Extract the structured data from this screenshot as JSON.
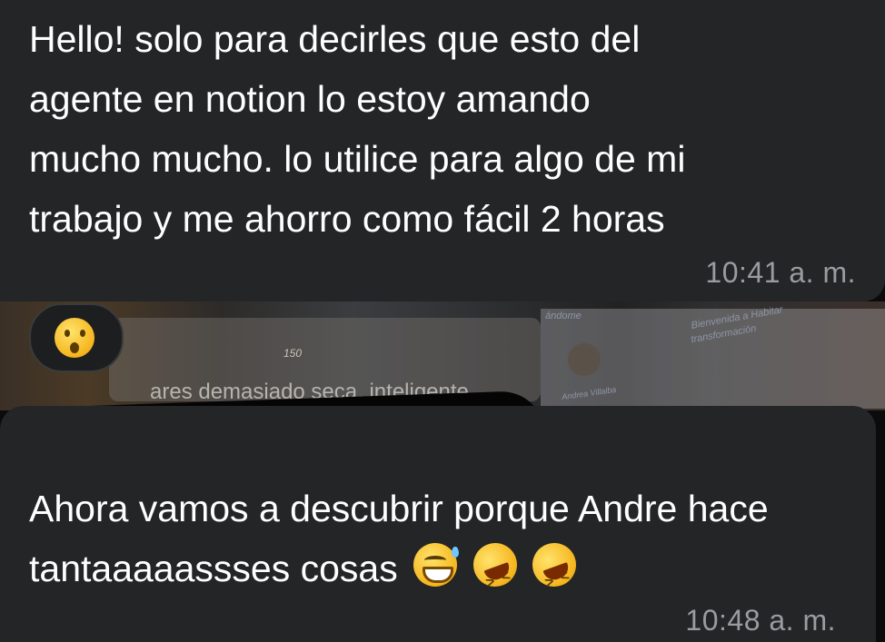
{
  "messages": [
    {
      "text": "Hello! solo para decirles que esto del\nagente en notion lo estoy amando\nmucho mucho. lo utilice para algo de mi\ntrabajo y me ahorro como fácil 2 horas",
      "time": "10:41 a. m."
    },
    {
      "text": "Ahora vamos a descubrir porque Andre hace tantaaaaassses cosas",
      "time": "10:48 a. m.",
      "emojis": [
        "grinning-sweat-icon",
        "rofl-icon",
        "rofl-icon"
      ]
    }
  ],
  "reaction": {
    "emoji": "astonished-face-icon"
  },
  "background": {
    "blurred_text": "ares demasiado seca, inteligente,",
    "num": "150",
    "label1": "ándome",
    "label2": "Bienvenida a Habitar",
    "label3": "transformación",
    "label4": "Andrea Villalba"
  },
  "colors": {
    "bubble": "#232527",
    "page": "#0b0b0c",
    "timestamp": "#9a9c9f"
  }
}
